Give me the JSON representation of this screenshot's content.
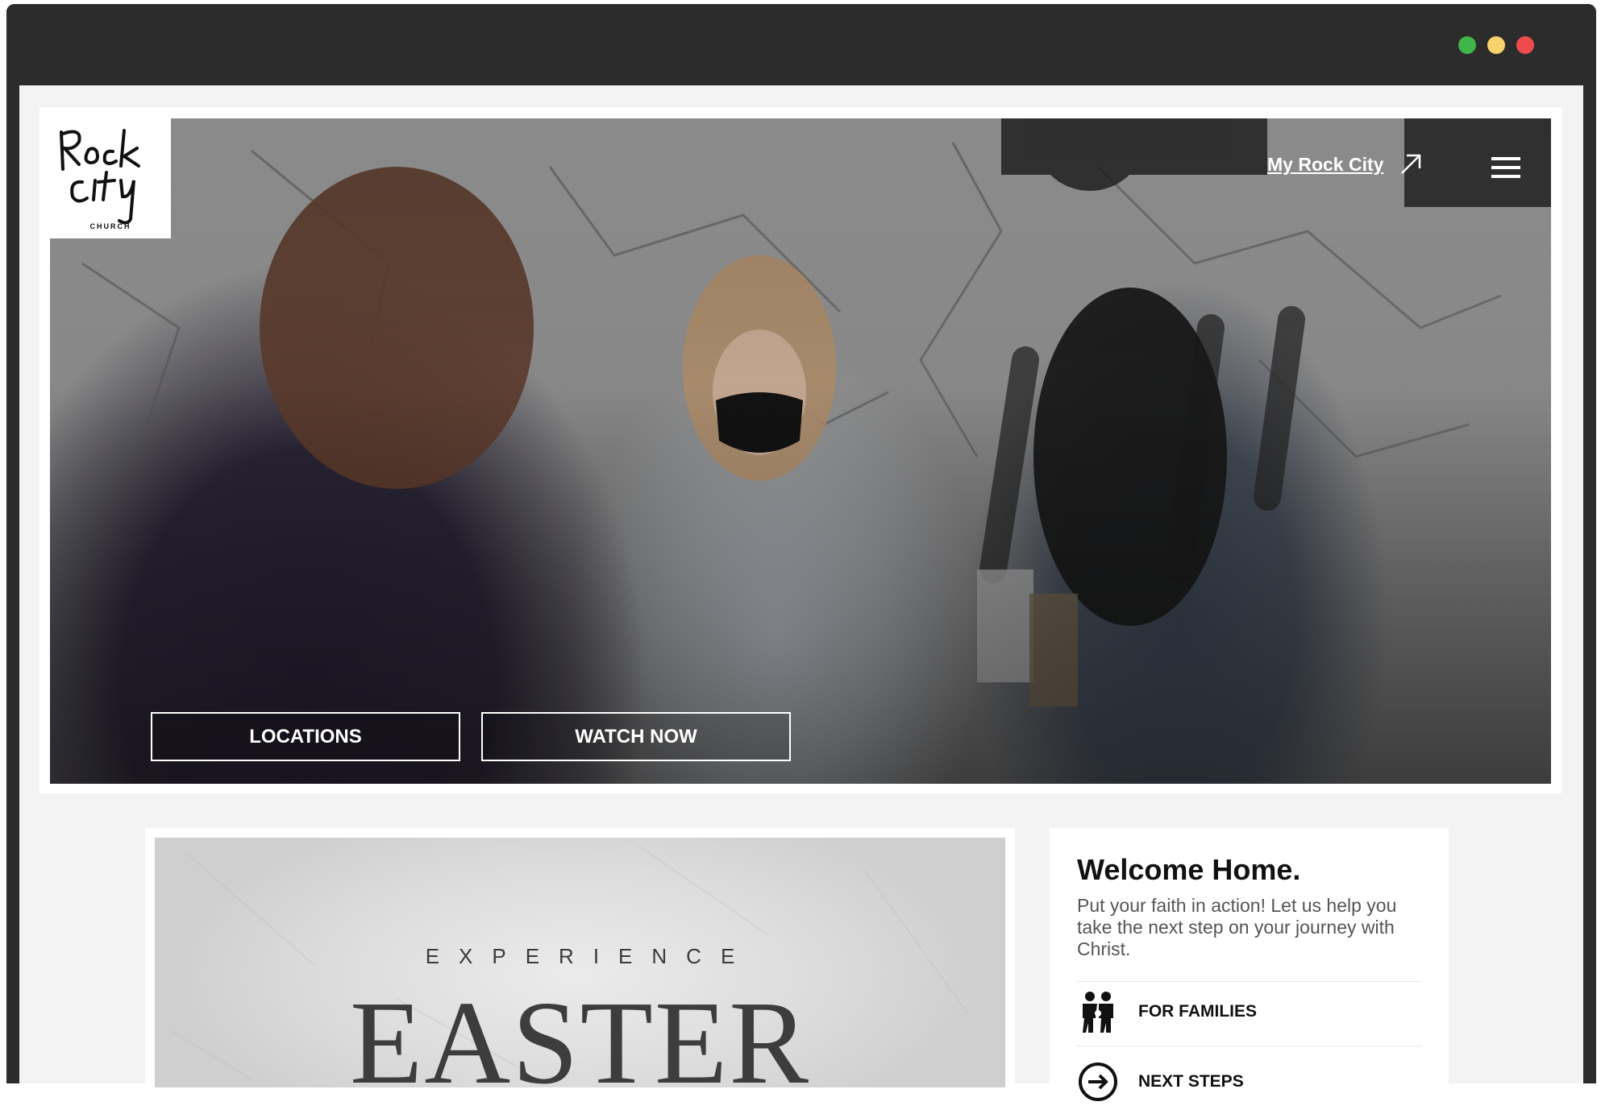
{
  "browser": {
    "traffic_lights": [
      "#3fb54a",
      "#f6d46b",
      "#ee4c4c"
    ]
  },
  "header": {
    "logo_text": [
      "Rock",
      "City",
      "CHURCH"
    ],
    "my_rock_city": "My Rock City",
    "menu_icon": "hamburger-icon"
  },
  "hero": {
    "buttons": {
      "locations": "LOCATIONS",
      "watch_now": "WATCH NOW"
    }
  },
  "feature": {
    "kicker": "EXPERIENCE",
    "title": "EASTER"
  },
  "welcome": {
    "title": "Welcome Home.",
    "text": "Put your faith in action! Let us help you take the next step on your journey with Christ.",
    "links": [
      {
        "label": "FOR FAMILIES",
        "icon": "family-icon"
      },
      {
        "label": "NEXT STEPS",
        "icon": "arrow-circle-icon"
      }
    ]
  }
}
